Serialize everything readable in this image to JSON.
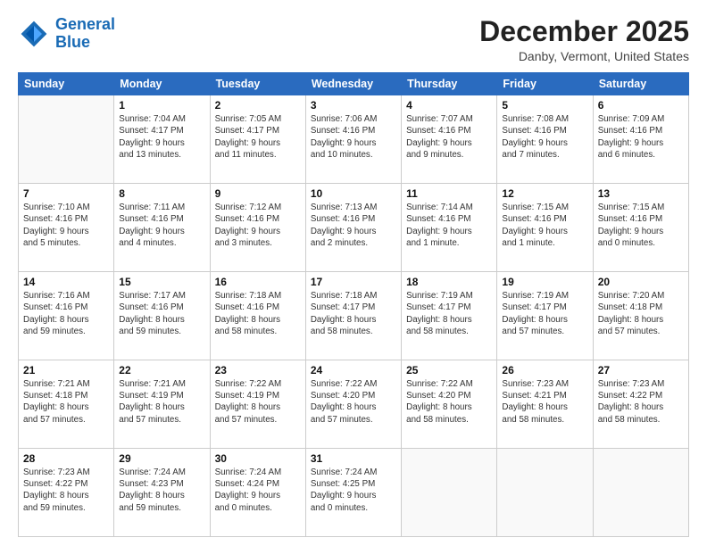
{
  "header": {
    "logo_line1": "General",
    "logo_line2": "Blue",
    "month": "December 2025",
    "location": "Danby, Vermont, United States"
  },
  "days_of_week": [
    "Sunday",
    "Monday",
    "Tuesday",
    "Wednesday",
    "Thursday",
    "Friday",
    "Saturday"
  ],
  "weeks": [
    [
      {
        "day": "",
        "info": ""
      },
      {
        "day": "1",
        "info": "Sunrise: 7:04 AM\nSunset: 4:17 PM\nDaylight: 9 hours\nand 13 minutes."
      },
      {
        "day": "2",
        "info": "Sunrise: 7:05 AM\nSunset: 4:17 PM\nDaylight: 9 hours\nand 11 minutes."
      },
      {
        "day": "3",
        "info": "Sunrise: 7:06 AM\nSunset: 4:16 PM\nDaylight: 9 hours\nand 10 minutes."
      },
      {
        "day": "4",
        "info": "Sunrise: 7:07 AM\nSunset: 4:16 PM\nDaylight: 9 hours\nand 9 minutes."
      },
      {
        "day": "5",
        "info": "Sunrise: 7:08 AM\nSunset: 4:16 PM\nDaylight: 9 hours\nand 7 minutes."
      },
      {
        "day": "6",
        "info": "Sunrise: 7:09 AM\nSunset: 4:16 PM\nDaylight: 9 hours\nand 6 minutes."
      }
    ],
    [
      {
        "day": "7",
        "info": "Sunrise: 7:10 AM\nSunset: 4:16 PM\nDaylight: 9 hours\nand 5 minutes."
      },
      {
        "day": "8",
        "info": "Sunrise: 7:11 AM\nSunset: 4:16 PM\nDaylight: 9 hours\nand 4 minutes."
      },
      {
        "day": "9",
        "info": "Sunrise: 7:12 AM\nSunset: 4:16 PM\nDaylight: 9 hours\nand 3 minutes."
      },
      {
        "day": "10",
        "info": "Sunrise: 7:13 AM\nSunset: 4:16 PM\nDaylight: 9 hours\nand 2 minutes."
      },
      {
        "day": "11",
        "info": "Sunrise: 7:14 AM\nSunset: 4:16 PM\nDaylight: 9 hours\nand 1 minute."
      },
      {
        "day": "12",
        "info": "Sunrise: 7:15 AM\nSunset: 4:16 PM\nDaylight: 9 hours\nand 1 minute."
      },
      {
        "day": "13",
        "info": "Sunrise: 7:15 AM\nSunset: 4:16 PM\nDaylight: 9 hours\nand 0 minutes."
      }
    ],
    [
      {
        "day": "14",
        "info": "Sunrise: 7:16 AM\nSunset: 4:16 PM\nDaylight: 8 hours\nand 59 minutes."
      },
      {
        "day": "15",
        "info": "Sunrise: 7:17 AM\nSunset: 4:16 PM\nDaylight: 8 hours\nand 59 minutes."
      },
      {
        "day": "16",
        "info": "Sunrise: 7:18 AM\nSunset: 4:16 PM\nDaylight: 8 hours\nand 58 minutes."
      },
      {
        "day": "17",
        "info": "Sunrise: 7:18 AM\nSunset: 4:17 PM\nDaylight: 8 hours\nand 58 minutes."
      },
      {
        "day": "18",
        "info": "Sunrise: 7:19 AM\nSunset: 4:17 PM\nDaylight: 8 hours\nand 58 minutes."
      },
      {
        "day": "19",
        "info": "Sunrise: 7:19 AM\nSunset: 4:17 PM\nDaylight: 8 hours\nand 57 minutes."
      },
      {
        "day": "20",
        "info": "Sunrise: 7:20 AM\nSunset: 4:18 PM\nDaylight: 8 hours\nand 57 minutes."
      }
    ],
    [
      {
        "day": "21",
        "info": "Sunrise: 7:21 AM\nSunset: 4:18 PM\nDaylight: 8 hours\nand 57 minutes."
      },
      {
        "day": "22",
        "info": "Sunrise: 7:21 AM\nSunset: 4:19 PM\nDaylight: 8 hours\nand 57 minutes."
      },
      {
        "day": "23",
        "info": "Sunrise: 7:22 AM\nSunset: 4:19 PM\nDaylight: 8 hours\nand 57 minutes."
      },
      {
        "day": "24",
        "info": "Sunrise: 7:22 AM\nSunset: 4:20 PM\nDaylight: 8 hours\nand 57 minutes."
      },
      {
        "day": "25",
        "info": "Sunrise: 7:22 AM\nSunset: 4:20 PM\nDaylight: 8 hours\nand 58 minutes."
      },
      {
        "day": "26",
        "info": "Sunrise: 7:23 AM\nSunset: 4:21 PM\nDaylight: 8 hours\nand 58 minutes."
      },
      {
        "day": "27",
        "info": "Sunrise: 7:23 AM\nSunset: 4:22 PM\nDaylight: 8 hours\nand 58 minutes."
      }
    ],
    [
      {
        "day": "28",
        "info": "Sunrise: 7:23 AM\nSunset: 4:22 PM\nDaylight: 8 hours\nand 59 minutes."
      },
      {
        "day": "29",
        "info": "Sunrise: 7:24 AM\nSunset: 4:23 PM\nDaylight: 8 hours\nand 59 minutes."
      },
      {
        "day": "30",
        "info": "Sunrise: 7:24 AM\nSunset: 4:24 PM\nDaylight: 9 hours\nand 0 minutes."
      },
      {
        "day": "31",
        "info": "Sunrise: 7:24 AM\nSunset: 4:25 PM\nDaylight: 9 hours\nand 0 minutes."
      },
      {
        "day": "",
        "info": ""
      },
      {
        "day": "",
        "info": ""
      },
      {
        "day": "",
        "info": ""
      }
    ]
  ]
}
